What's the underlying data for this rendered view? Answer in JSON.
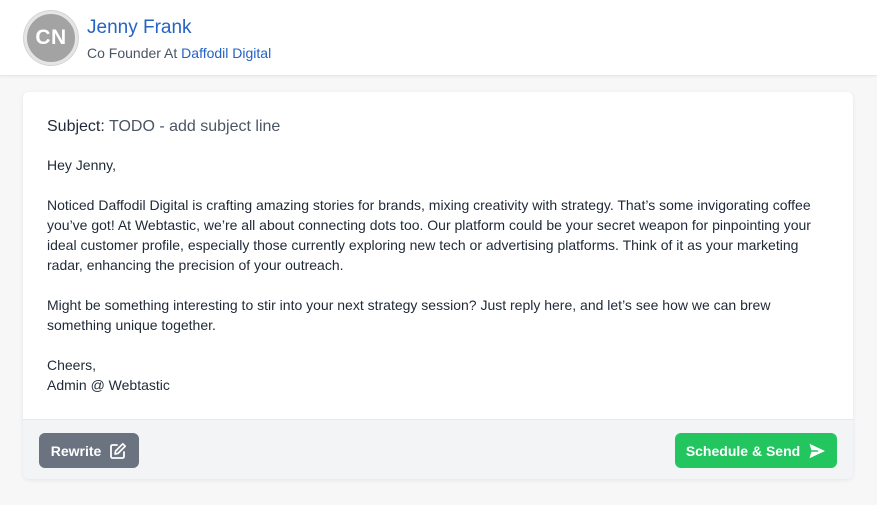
{
  "contact": {
    "initials": "CN",
    "name": "Jenny Frank",
    "role_prefix": "Co Founder At ",
    "company": "Daffodil Digital"
  },
  "email": {
    "subject_label": "Subject:",
    "subject_value": " TODO - add subject line",
    "greeting": "Hey Jenny,",
    "paragraph1": "Noticed Daffodil Digital is crafting amazing stories for brands, mixing creativity with strategy. That’s some invigorating coffee you’ve got! At Webtastic, we’re all about connecting dots too. Our platform could be your secret weapon for pinpointing your ideal customer profile, especially those currently exploring new tech or advertising platforms. Think of it as your marketing radar, enhancing the precision of your outreach.",
    "paragraph2": "Might be something interesting to stir into your next strategy session? Just reply here, and let’s see how we can brew something unique together.",
    "signoff": "Cheers,",
    "signature": "Admin @ Webtastic"
  },
  "actions": {
    "rewrite_label": "Rewrite",
    "rewrite_icon": "edit-icon",
    "send_label": "Schedule & Send",
    "send_icon": "paper-plane-icon"
  },
  "colors": {
    "accent_blue": "#2563c4",
    "rewrite_button": "#6b7280",
    "send_button": "#22c55e",
    "avatar_bg": "#a3a3a3"
  }
}
